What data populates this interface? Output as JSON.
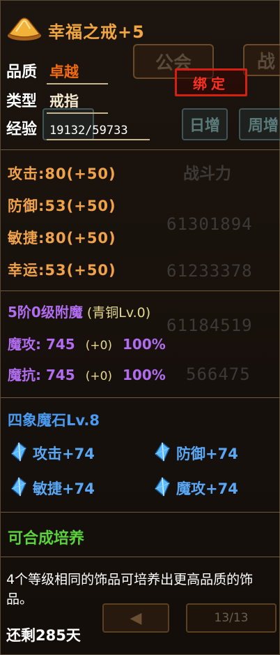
{
  "item": {
    "name": "幸福之戒+5",
    "quality_label": "品质",
    "quality_value": "卓越",
    "type_label": "类型",
    "type_value": "戒指",
    "xp_label": "经验",
    "xp_value": "19132/59733",
    "bind_label": "绑定"
  },
  "stats": [
    "攻击:80(+50)",
    "防御:53(+50)",
    "敏捷:80(+50)",
    "幸运:53(+50)"
  ],
  "enchant": {
    "title": "5阶0级附魔",
    "material": "(青铜Lv.0)",
    "rows": [
      {
        "name": "魔攻:",
        "value": "745",
        "bonus": "(+0)",
        "pct": "100%"
      },
      {
        "name": "魔抗:",
        "value": "745",
        "bonus": "(+0)",
        "pct": "100%"
      }
    ]
  },
  "magic_stone": {
    "title": "四象魔石Lv.8",
    "gems": [
      "攻击+74",
      "防御+74",
      "敏捷+74",
      "魔攻+74"
    ]
  },
  "cultivate": "可合成培养",
  "description": "4个等级相同的饰品可培养出更高品质的饰品。",
  "remaining": "还剩285天",
  "background_ui": {
    "tab_guild": "公会",
    "tab_war": "战",
    "btn_daily": "日增",
    "btn_weekly": "周增",
    "header_power": "战斗力",
    "power_values": [
      "61301894",
      "61233378",
      "61184519",
      "566475"
    ],
    "page": "13/13"
  },
  "colors": {
    "title": "#f0a640",
    "stat": "#f0a24a",
    "enchant": "#b26cf0",
    "stone": "#4a9af0",
    "cultivate": "#5ad23a",
    "bind": "#ff3020"
  }
}
